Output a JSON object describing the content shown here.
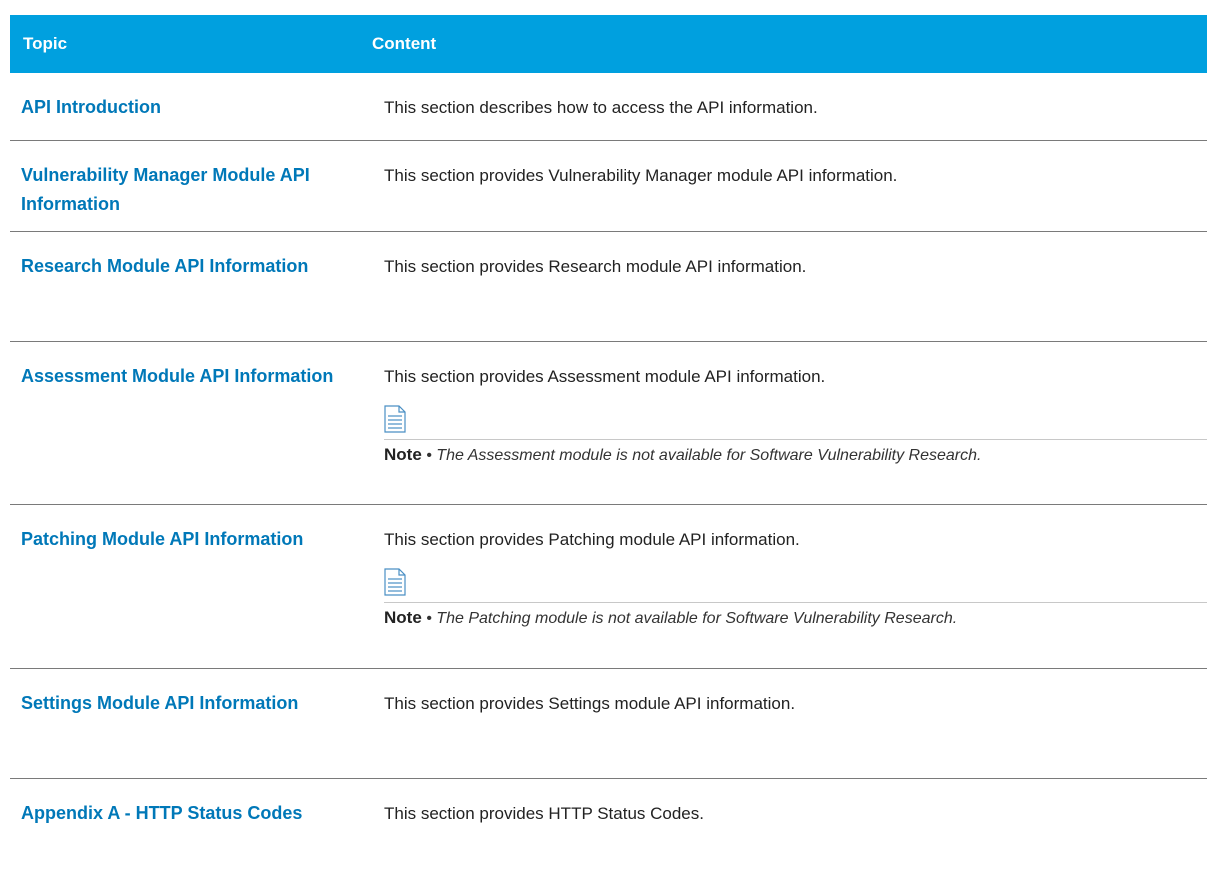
{
  "table": {
    "headers": {
      "topic": "Topic",
      "content": "Content"
    },
    "rows": [
      {
        "topic": "API Introduction",
        "content": "This section describes how to access the API information."
      },
      {
        "topic": "Vulnerability Manager Module API Information",
        "content": "This section provides Vulnerability Manager module API information."
      },
      {
        "topic": "Research Module API Information",
        "content": "This section provides Research module API information."
      },
      {
        "topic": "Assessment Module API Information",
        "content": "This section provides Assessment module API information.",
        "note_label": "Note",
        "note_sep": "•",
        "note_text": "The Assessment module is not available for Software Vulnerability Research."
      },
      {
        "topic": "Patching Module API Information",
        "content": "This section provides Patching module API information.",
        "note_label": "Note",
        "note_sep": "•",
        "note_text": "The Patching module is not available for Software Vulnerability Research."
      },
      {
        "topic": "Settings Module API Information",
        "content": "This section provides Settings module API information."
      },
      {
        "topic": "Appendix A - HTTP Status Codes",
        "content": "This section provides HTTP Status Codes."
      }
    ]
  },
  "colors": {
    "header_bg": "#00a0df",
    "link": "#0078b8"
  },
  "icons": {
    "note": "document-note-icon"
  }
}
